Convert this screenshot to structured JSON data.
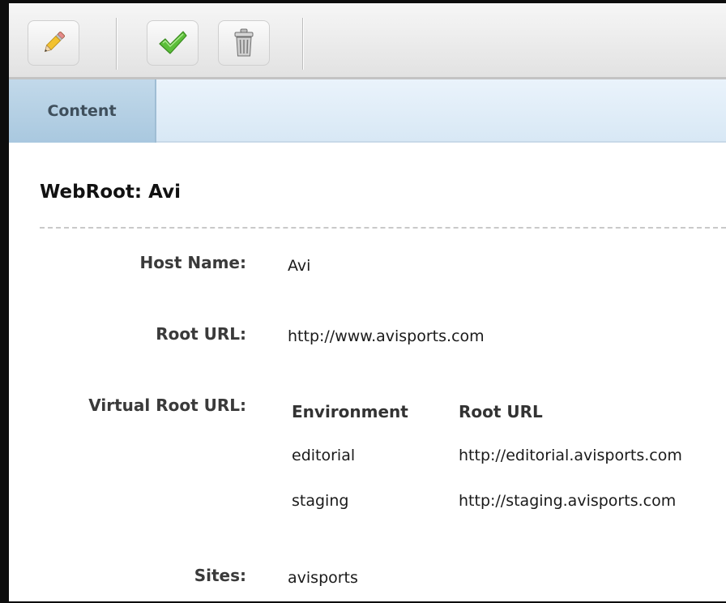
{
  "toolbar": {
    "buttons": [
      {
        "icon": "pencil-icon",
        "label": "Edit"
      },
      {
        "icon": "checkmark-icon",
        "label": "Approve"
      },
      {
        "icon": "trash-icon",
        "label": "Delete"
      }
    ]
  },
  "tabs": [
    {
      "label": "Content"
    }
  ],
  "content": {
    "heading": "WebRoot: Avi",
    "fields": {
      "host_name": {
        "label": "Host Name:",
        "value": "Avi"
      },
      "root_url": {
        "label": "Root URL:",
        "value": "http://www.avisports.com"
      },
      "virtual_root_url": {
        "label": "Virtual Root URL:",
        "columns": [
          "Environment",
          "Root URL"
        ],
        "rows": [
          [
            "editorial",
            "http://editorial.avisports.com"
          ],
          [
            "staging",
            "http://staging.avisports.com"
          ]
        ]
      },
      "sites": {
        "label": "Sites:",
        "value": "avisports"
      }
    }
  },
  "colors": {
    "tab_active": "#b5d0e4",
    "tab_strip": "#e0edf8",
    "toolbar": "#ececec"
  }
}
